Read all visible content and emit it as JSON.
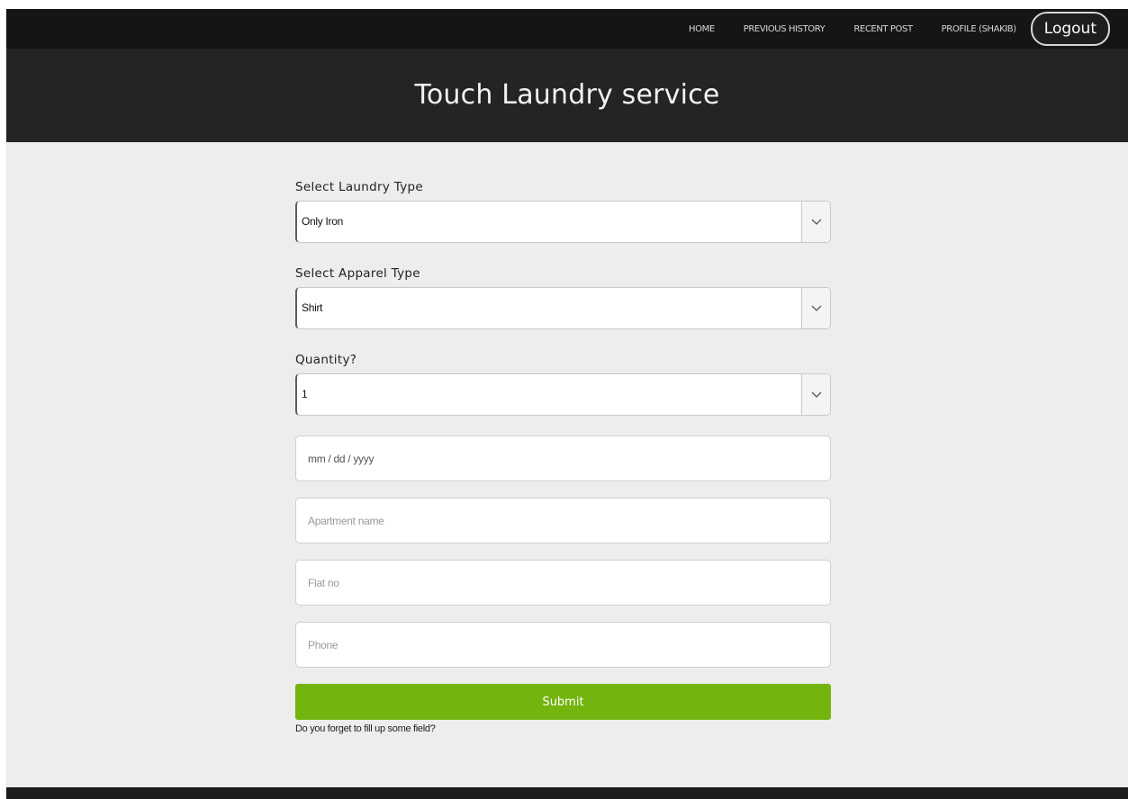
{
  "nav": {
    "links": [
      "HOME",
      "PREVIOUS HISTORY",
      "RECENT POST",
      "PROFILE (SHAKIB)"
    ],
    "logout_label": "Logout"
  },
  "hero": {
    "title": "Touch Laundry service"
  },
  "form": {
    "laundry_type": {
      "label": "Select Laundry Type",
      "value": "Only Iron"
    },
    "apparel_type": {
      "label": "Select Apparel Type",
      "value": "Shirt"
    },
    "quantity": {
      "label": "Quantity?",
      "value": "1"
    },
    "date": {
      "placeholder": "mm / dd / yyyy"
    },
    "apartment": {
      "placeholder": "Apartment name"
    },
    "flat": {
      "placeholder": "Flat no"
    },
    "phone": {
      "placeholder": "Phone"
    },
    "submit_label": "Submit",
    "hint": "Do you forget to fill up some field?"
  },
  "colors": {
    "topbar": "#151515",
    "hero": "#242424",
    "page_background": "#ededed",
    "submit": "#74b40e"
  },
  "icons": {
    "select_arrow": "chevron-down-icon"
  }
}
